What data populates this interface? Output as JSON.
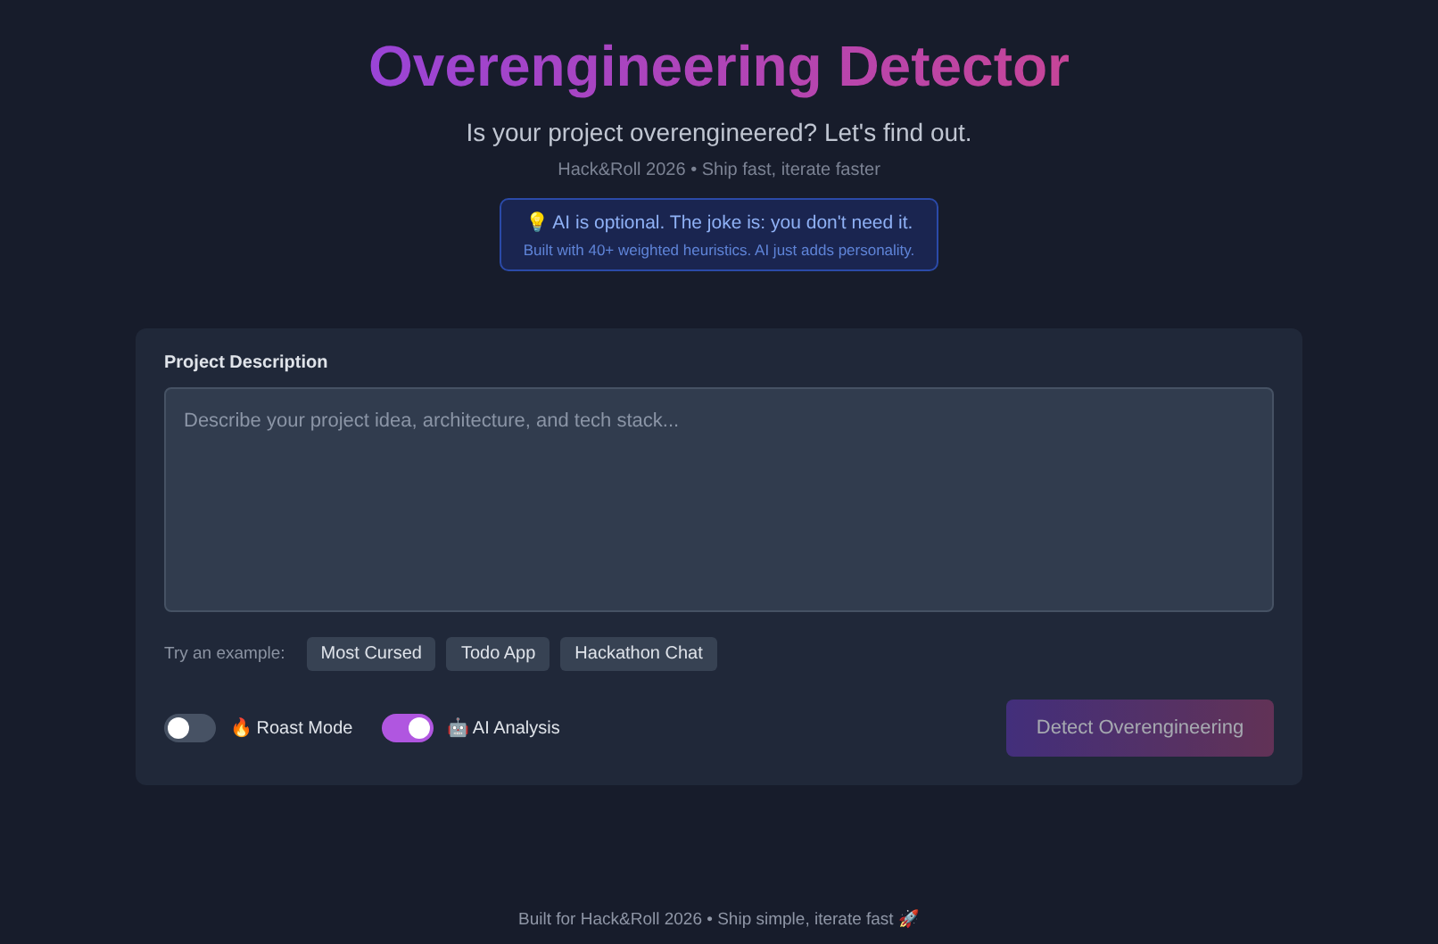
{
  "header": {
    "title": "Overengineering Detector",
    "subtitle": "Is your project overengineered? Let's find out.",
    "tagline": "Hack&Roll 2026 • Ship fast, iterate faster"
  },
  "notice": {
    "headline": "💡 AI is optional. The joke is: you don't need it.",
    "detail": "Built with 40+ weighted heuristics. AI just adds personality."
  },
  "form": {
    "label": "Project Description",
    "placeholder": "Describe your project idea, architecture, and tech stack...",
    "examples_label": "Try an example:",
    "examples": [
      "Most Cursed",
      "Todo App",
      "Hackathon Chat"
    ],
    "toggles": [
      {
        "label": "🔥 Roast Mode",
        "on": false
      },
      {
        "label": "🤖 AI Analysis",
        "on": true
      }
    ],
    "submit": {
      "label": "Detect Overengineering",
      "disabled": true
    }
  },
  "footer": "Built for Hack&Roll 2026 • Ship simple, iterate fast 🚀"
}
